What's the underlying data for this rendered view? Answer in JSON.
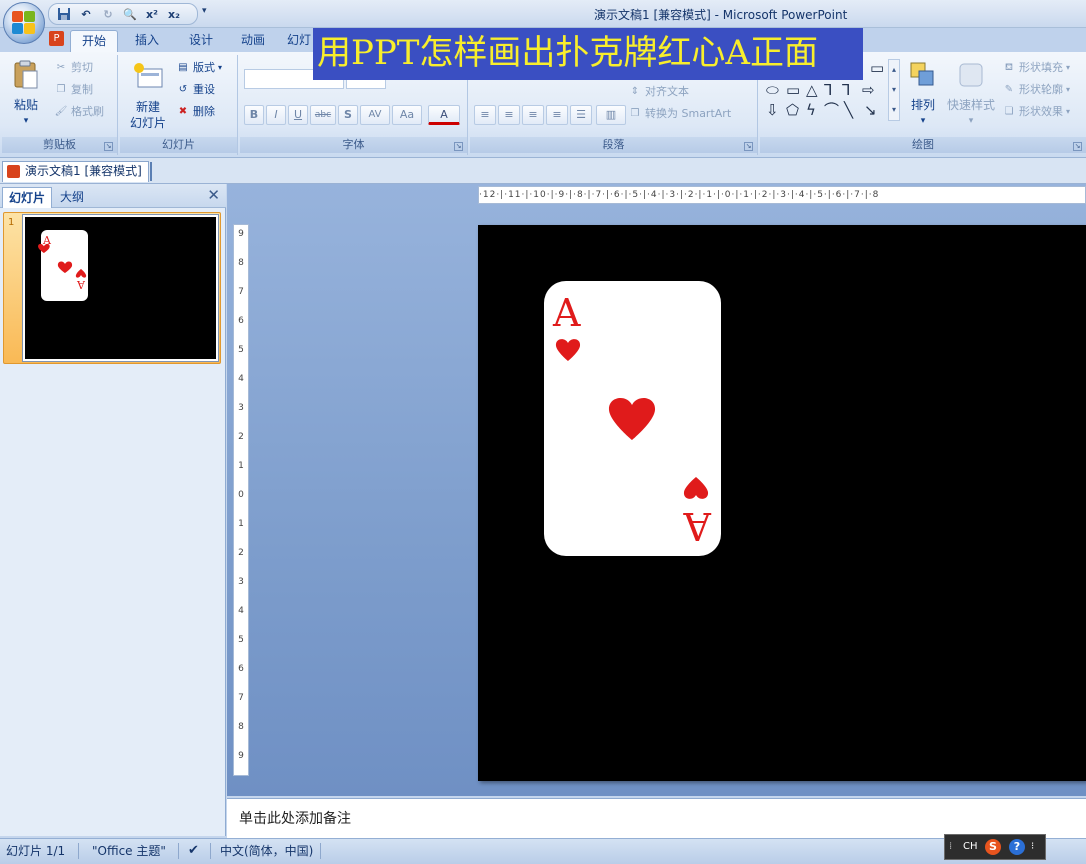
{
  "window": {
    "title": "演示文稿1 [兼容模式] - Microsoft PowerPoint"
  },
  "overlay": {
    "banner": "用PPT怎样画出扑克牌红心A正面"
  },
  "quick_access": {
    "items": [
      "save-icon",
      "undo-icon",
      "redo-icon",
      "print-preview-icon",
      "superscript-icon",
      "subscript-icon"
    ],
    "superscript": "x²",
    "subscript": "x₂"
  },
  "ribbon_tabs": [
    {
      "label": "开始",
      "active": true
    },
    {
      "label": "插入",
      "active": false
    },
    {
      "label": "设计",
      "active": false
    },
    {
      "label": "动画",
      "active": false
    },
    {
      "label": "幻灯",
      "active": false
    }
  ],
  "clipboard": {
    "label": "剪贴板",
    "paste": "粘贴",
    "cut": "剪切",
    "copy": "复制",
    "format_painter": "格式刷"
  },
  "slides_group": {
    "label": "幻灯片",
    "new_slide_1": "新建",
    "new_slide_2": "幻灯片",
    "layout": "版式",
    "reset": "重设",
    "delete": "删除"
  },
  "font_group": {
    "label": "字体",
    "bold": "B",
    "italic": "I",
    "underline": "U",
    "strike": "abc",
    "shadow": "S",
    "spacing": "AV",
    "case": "Aa",
    "color": "A"
  },
  "paragraph_group": {
    "label": "段落",
    "align_text": "对齐文本",
    "convert_smartart": "转换为 SmartArt"
  },
  "drawing_group": {
    "label": "绘图",
    "arrange": "排列",
    "quick_styles": "快速样式",
    "shape_fill": "形状填充",
    "shape_outline": "形状轮廓",
    "shape_effects": "形状效果"
  },
  "document_tab": {
    "label": "演示文稿1 [兼容模式]"
  },
  "left_panel": {
    "tab_slides": "幻灯片",
    "tab_outline": "大纲",
    "slide_number": "1"
  },
  "ruler": {
    "horizontal": "·12·|·11·|·10·|·9·|·8·|·7·|·6·|·5·|·4·|·3·|·2·|·1·|·0·|·1·|·2·|·3·|·4·|·5·|·6·|·7·|·8",
    "vertical": [
      "9",
      "8",
      "7",
      "6",
      "5",
      "4",
      "3",
      "2",
      "1",
      "0",
      "1",
      "2",
      "3",
      "4",
      "5",
      "6",
      "7",
      "8",
      "9"
    ]
  },
  "card": {
    "rank": "A",
    "suit": "heart",
    "color": "#e01b1b"
  },
  "notes": {
    "placeholder": "单击此处添加备注"
  },
  "status": {
    "slide_info": "幻灯片 1/1",
    "theme": "\"Office 主题\"",
    "language": "中文(简体，中国)"
  },
  "ime_bar": {
    "mode": "CH",
    "brand": "S",
    "help": "?"
  }
}
